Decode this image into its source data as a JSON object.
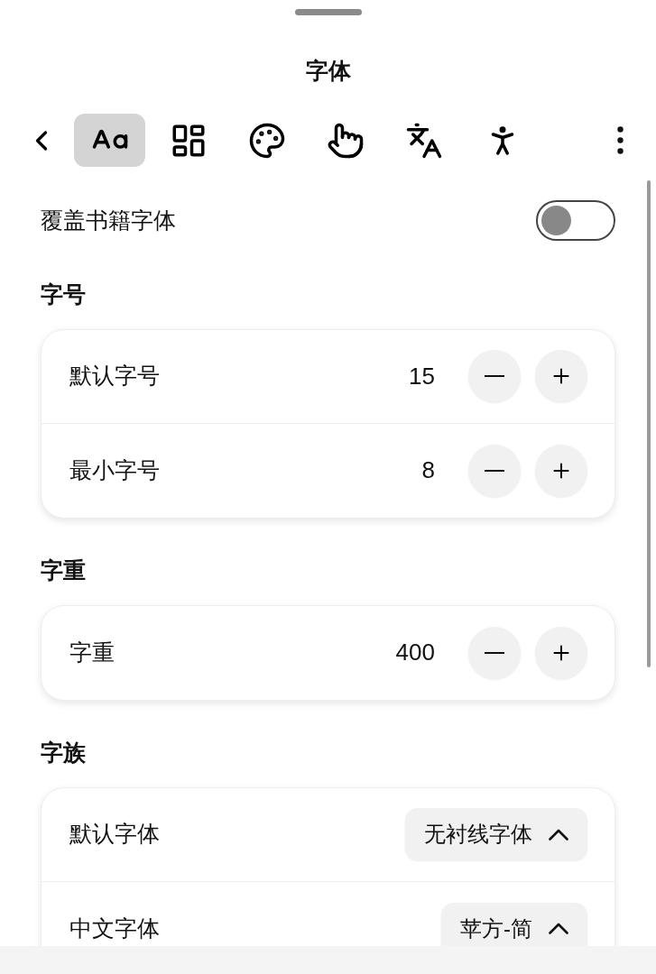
{
  "title": "字体",
  "toolbar": {
    "tabs": [
      {
        "kind": "font",
        "selected": true
      },
      {
        "kind": "layout",
        "selected": false
      },
      {
        "kind": "palette",
        "selected": false
      },
      {
        "kind": "touch",
        "selected": false
      },
      {
        "kind": "translate",
        "selected": false
      },
      {
        "kind": "accessibility",
        "selected": false
      }
    ]
  },
  "sections": [
    {
      "kind": "toggle",
      "label": "覆盖书籍字体",
      "on": false
    },
    {
      "kind": "group",
      "heading": "字号",
      "rows": [
        {
          "kind": "stepper",
          "label": "默认字号",
          "value": "15"
        },
        {
          "kind": "stepper",
          "label": "最小字号",
          "value": "8"
        }
      ]
    },
    {
      "kind": "group",
      "heading": "字重",
      "rows": [
        {
          "kind": "stepper",
          "label": "字重",
          "value": "400"
        }
      ]
    },
    {
      "kind": "group",
      "heading": "字族",
      "rows": [
        {
          "kind": "select",
          "label": "默认字体",
          "value": "无衬线字体"
        },
        {
          "kind": "select",
          "label": "中文字体",
          "value": "苹方-简"
        }
      ]
    }
  ]
}
